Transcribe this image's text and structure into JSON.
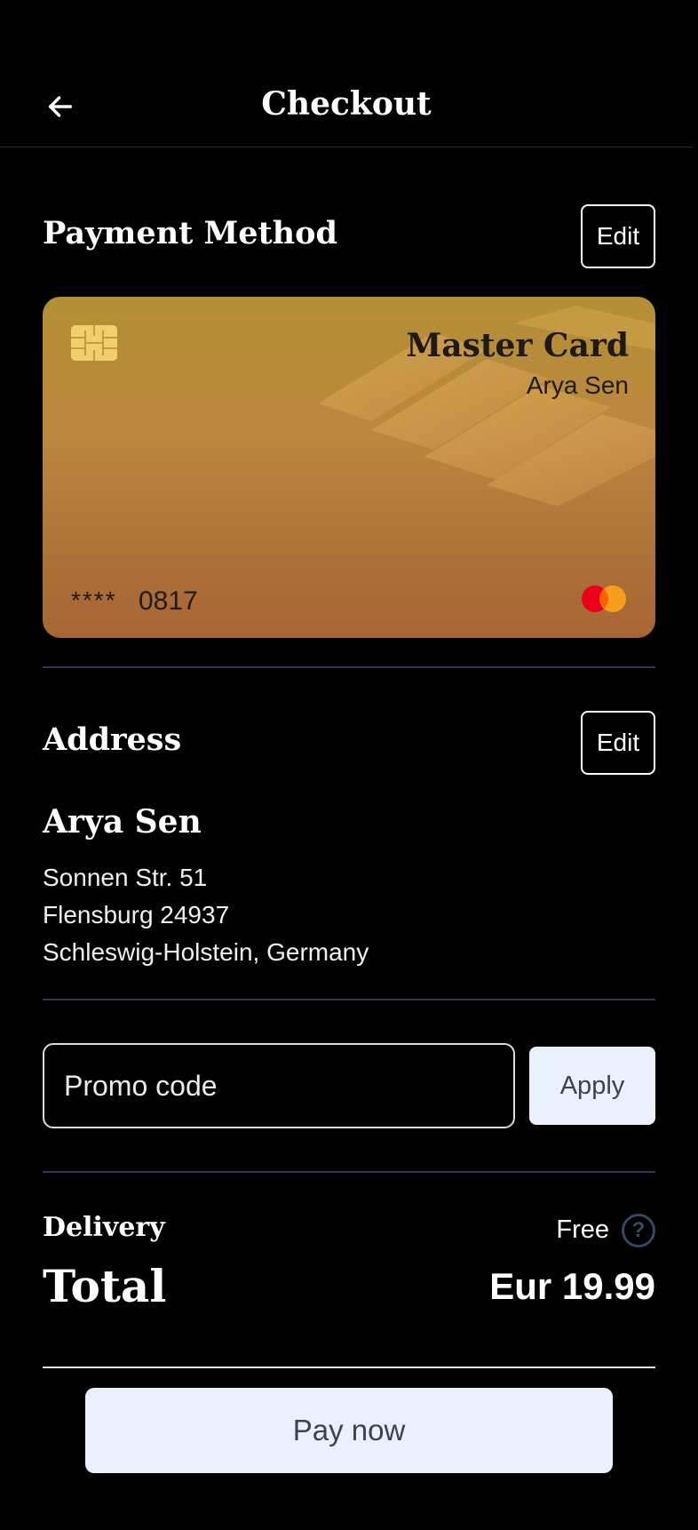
{
  "header": {
    "title": "Checkout",
    "back_icon": "arrow-left-icon"
  },
  "payment": {
    "section_title": "Payment Method",
    "edit_label": "Edit",
    "card": {
      "brand": "Master Card",
      "holder": "Arya Sen",
      "mask": "****",
      "last_digits": "0817",
      "chip_icon": "chip-icon",
      "network_icon": "mastercard-logo-icon"
    }
  },
  "address": {
    "section_title": "Address",
    "edit_label": "Edit",
    "name": "Arya Sen",
    "lines": [
      "Sonnen Str. 51",
      "Flensburg 24937",
      "Schleswig-Holstein, Germany"
    ]
  },
  "promo": {
    "placeholder": "Promo code",
    "apply_label": "Apply"
  },
  "summary": {
    "delivery_label": "Delivery",
    "delivery_value": "Free",
    "help_icon": "question-circle-icon",
    "help_glyph": "?",
    "total_label": "Total",
    "total_value": "Eur 19.99"
  },
  "pay_button_label": "Pay now",
  "colors": {
    "background": "#000000",
    "card_gold_top": "#b48f35",
    "card_gold_bottom": "#a86535",
    "button_bg": "#eaf1fd",
    "divider": "#2f3947"
  }
}
